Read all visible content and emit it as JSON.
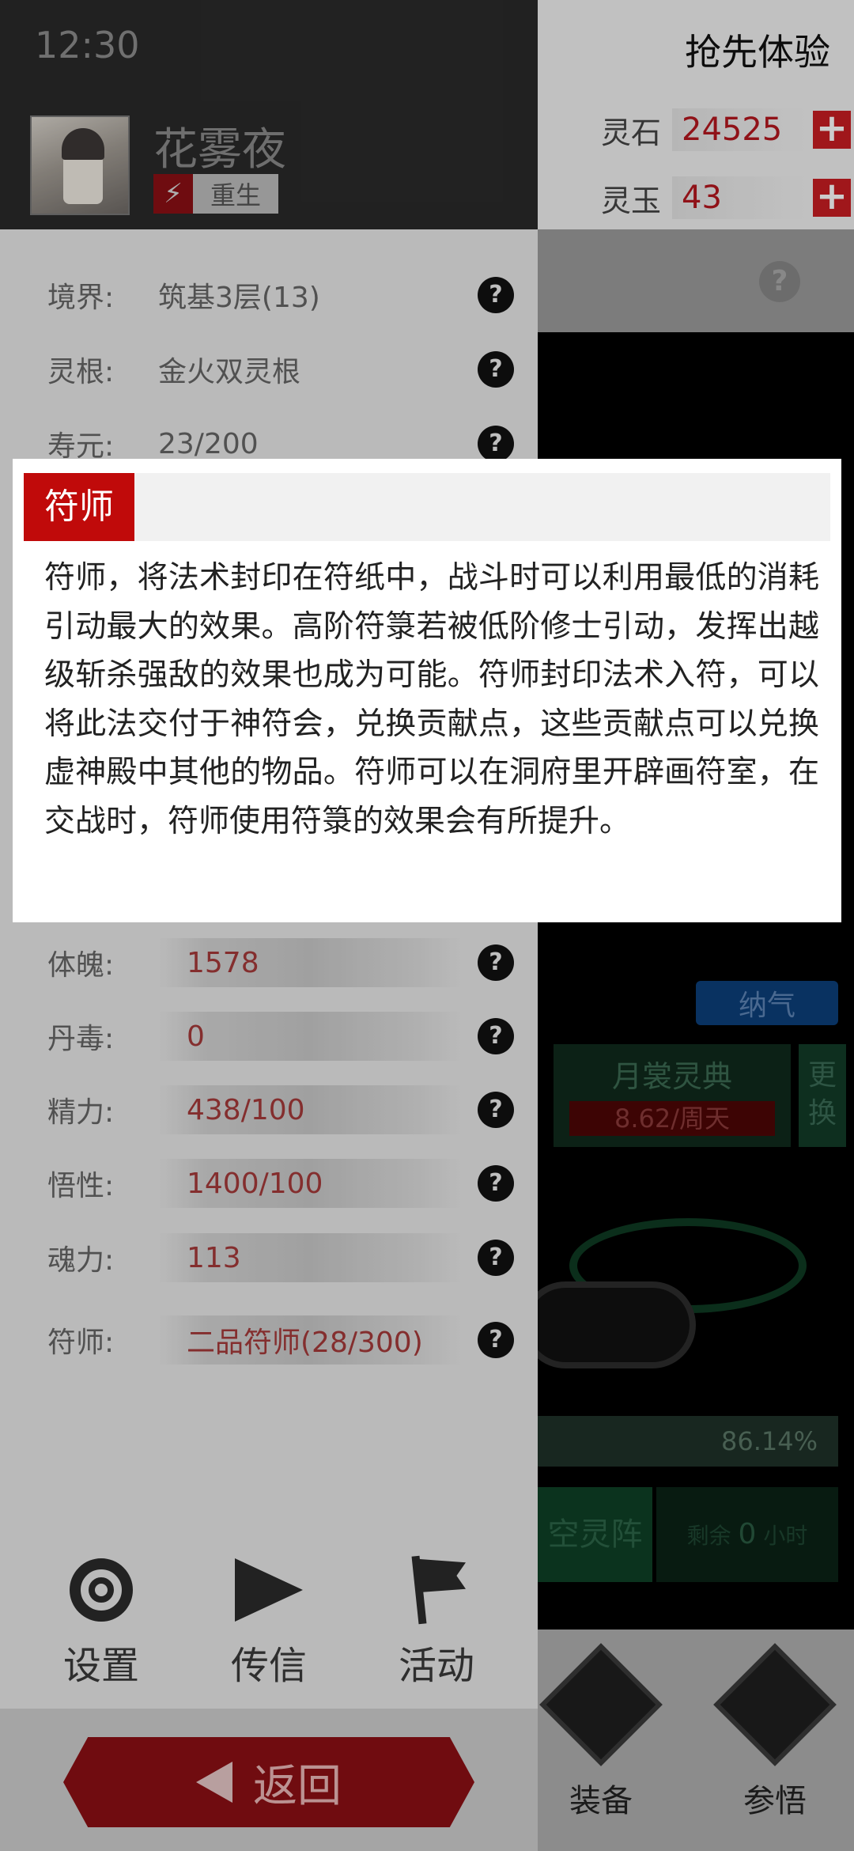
{
  "status_bar": {
    "time": "12:30"
  },
  "right_panel": {
    "early_access": "抢先体验",
    "resources": [
      {
        "label": "灵石",
        "value": "24525",
        "plus": "+"
      },
      {
        "label": "灵玉",
        "value": "43",
        "plus": "+"
      }
    ],
    "help": "?",
    "cultivation_badge": "纳气",
    "technique": {
      "name": "月裳灵典",
      "rate": "8.62/周天",
      "change": "更换"
    },
    "progress_text": "86.14%",
    "array_label": "空灵阵",
    "remaining": {
      "prefix": "剩余",
      "value": "0",
      "unit": "小时"
    },
    "tabs": [
      {
        "label": "装备"
      },
      {
        "label": "参悟"
      }
    ]
  },
  "profile": {
    "name": "花雾夜",
    "tag_icon": "⚡",
    "tag": "重生",
    "stats_top": [
      {
        "label": "境界:",
        "value": "筑基3层(13)"
      },
      {
        "label": "灵根:",
        "value": "金火双灵根"
      },
      {
        "label": "寿元:",
        "value": "23/200"
      }
    ],
    "stats_bottom": [
      {
        "label": "体魄:",
        "value": "1578"
      },
      {
        "label": "丹毒:",
        "value": "0"
      },
      {
        "label": "精力:",
        "value": "438/100"
      },
      {
        "label": "悟性:",
        "value": "1400/100"
      },
      {
        "label": "魂力:",
        "value": "113"
      },
      {
        "label": "符师:",
        "value": "二品符师(28/300)"
      }
    ],
    "help": "?"
  },
  "menu": {
    "settings": "设置",
    "message": "传信",
    "activity": "活动"
  },
  "back_button": "返回",
  "dialog": {
    "title": "符师",
    "body": "符师，将法术封印在符纸中，战斗时可以利用最低的消耗引动最大的效果。高阶符箓若被低阶修士引动，发挥出越级斩杀强敌的效果也成为可能。符师封印法术入符，可以将此法交付于神符会，兑换贡献点，这些贡献点可以兑换虚神殿中其他的物品。符师可以在洞府里开辟画符室，在交战时，符师使用符箓的效果会有所提升。"
  },
  "colors": {
    "accent": "#c00a0a",
    "stat_value": "#a53a3a",
    "resource_value": "#b5171e"
  }
}
